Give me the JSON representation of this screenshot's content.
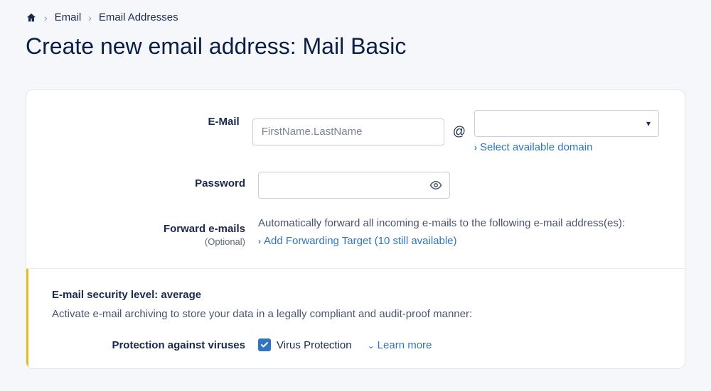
{
  "breadcrumb": {
    "home": "Home",
    "email": "Email",
    "addresses": "Email Addresses"
  },
  "page_title": "Create new email address: Mail Basic",
  "form": {
    "email_label": "E-Mail",
    "email_placeholder": "FirstName.LastName",
    "at_symbol": "@",
    "domain_value": "",
    "select_domain_link": "Select available domain",
    "password_label": "Password",
    "password_value": "",
    "forward_label": "Forward e-mails",
    "forward_optional": "(Optional)",
    "forward_desc": "Automatically forward all incoming e-mails to the following e-mail address(es):",
    "add_forward_link": "Add Forwarding Target (10 still available)"
  },
  "security": {
    "title": "E-mail security level: average",
    "desc": "Activate e-mail archiving to store your data in a legally compliant and audit-proof manner:",
    "virus_label": "Protection against viruses",
    "virus_checkbox_label": "Virus Protection",
    "virus_checked": true,
    "learn_more": "Learn more"
  }
}
